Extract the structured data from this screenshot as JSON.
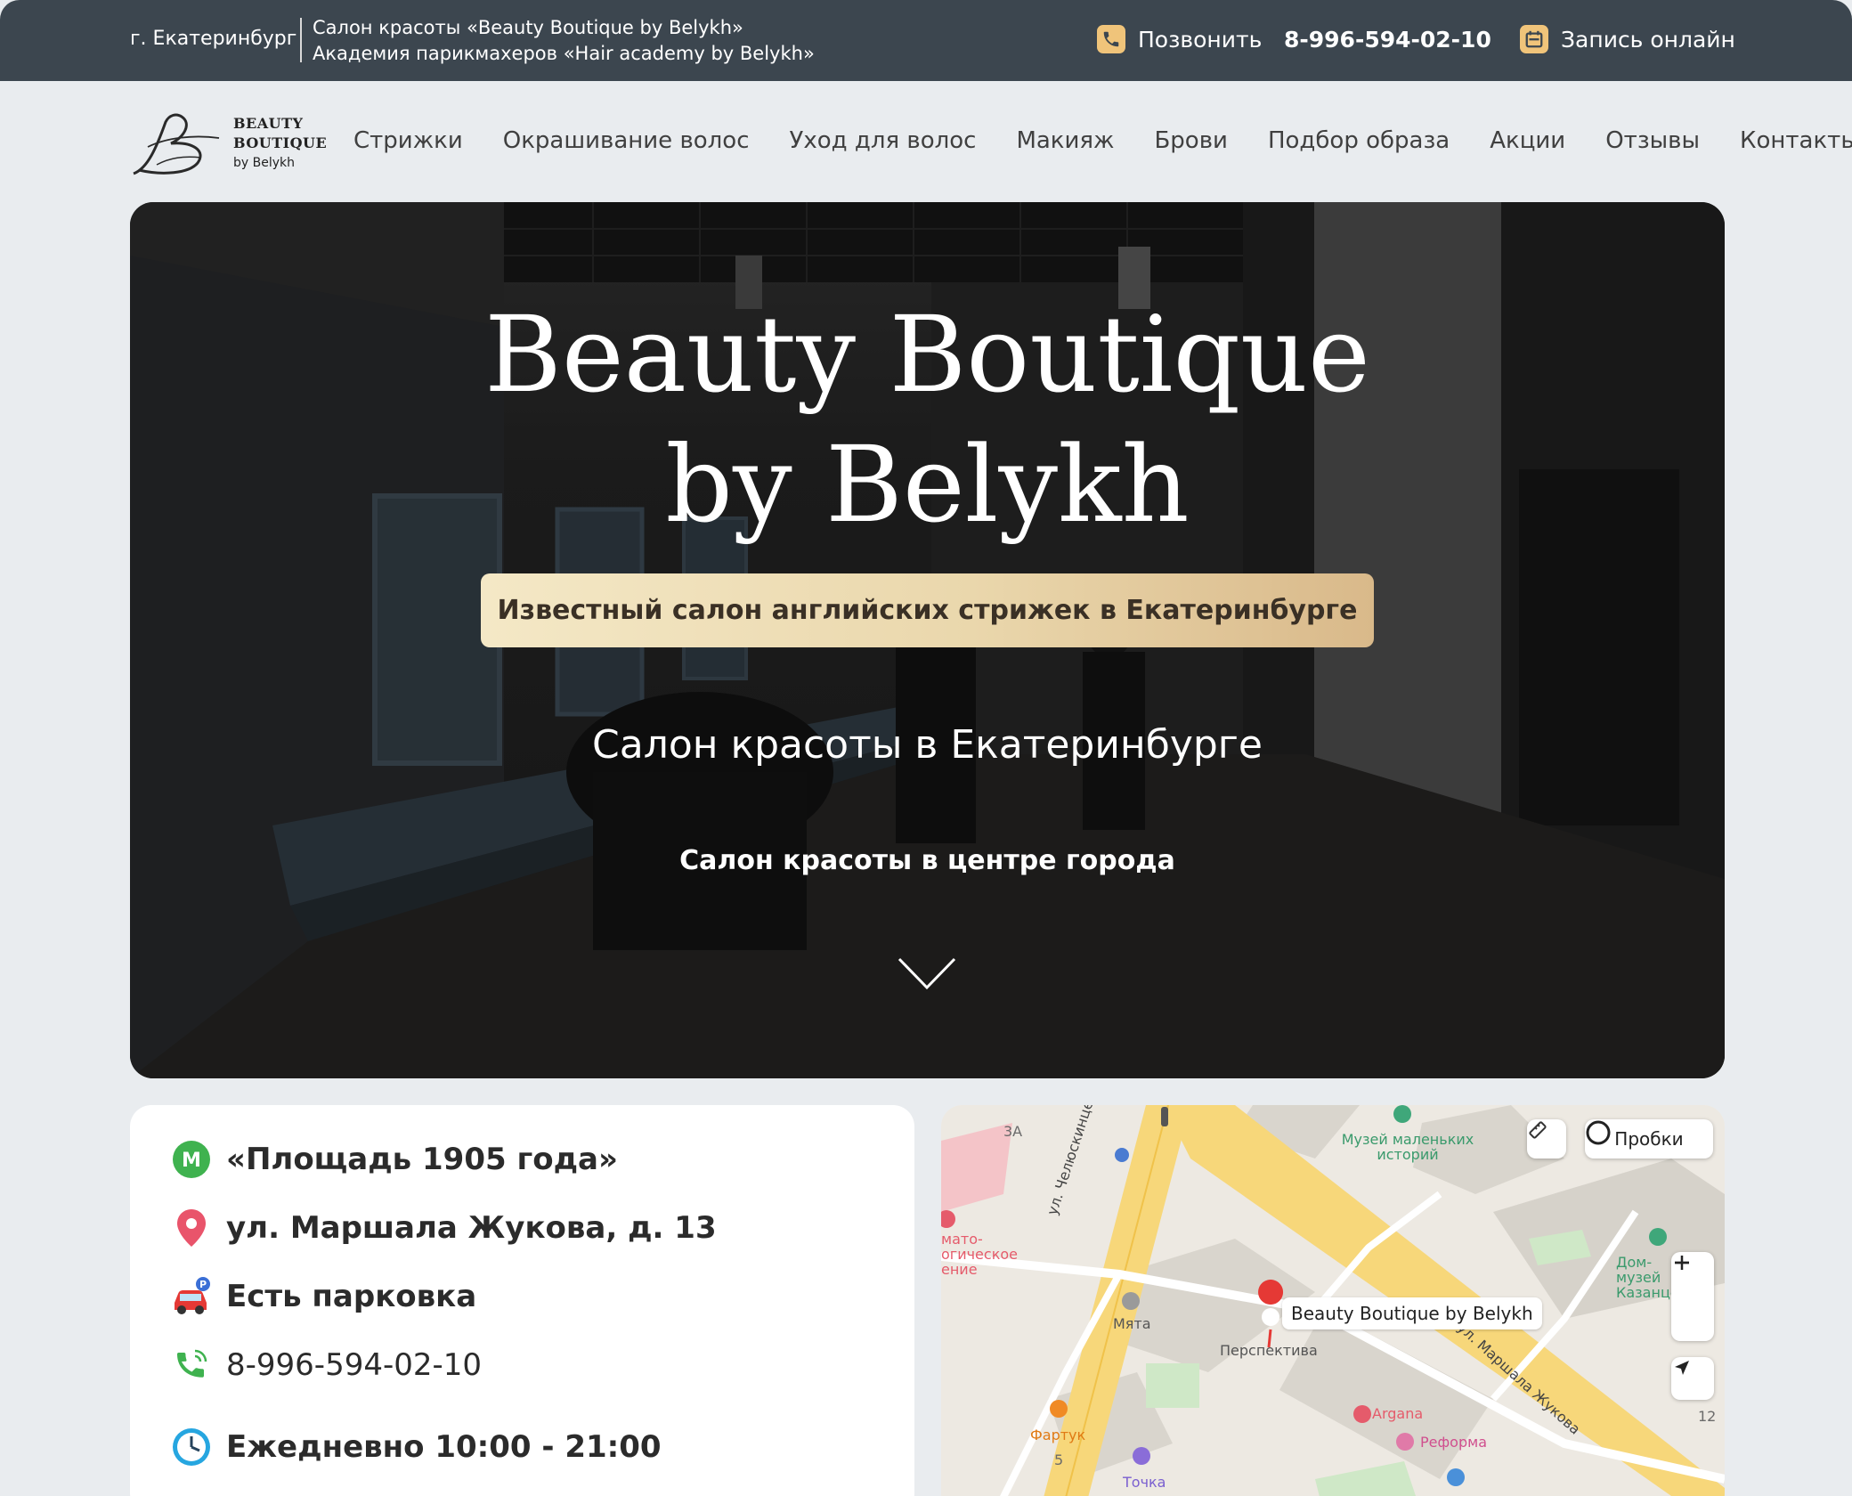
{
  "topbar": {
    "city": "г. Екатеринбург",
    "salon_line": "Салон красоты «Beauty Boutique by Belykh»",
    "academy_line": "Академия парикмахеров «Hair academy by Belykh»",
    "call_label": "Позвонить",
    "phone": "8-996-594-02-10",
    "book_label": "Запись онлайн"
  },
  "logo": {
    "line1": "BEAUTY",
    "line2": "BOUTIQUE",
    "line3": "by Belykh"
  },
  "menu": [
    "Стрижки",
    "Окрашивание волос",
    "Уход для волос",
    "Макияж",
    "Брови",
    "Подбор образа",
    "Акции",
    "Отзывы",
    "Контакты"
  ],
  "hero": {
    "title_line1": "Beauty Boutique",
    "title_line2": "by Belykh",
    "badge": "Известный салон английских стрижек в Екатеринбурге",
    "subtitle": "Салон красоты в Екатеринбурге",
    "tagline": "Салон красоты в центре города"
  },
  "info": {
    "metro_letter": "M",
    "metro": "«Площадь 1905 года»",
    "address": "ул. Маршала Жукова, д. 13",
    "parking": "Есть парковка",
    "phone": "8-996-594-02-10",
    "hours": "Ежедневно 10:00 - 21:00"
  },
  "map": {
    "traffic_label": "Пробки",
    "pin_label": "Beauty Boutique by Belykh",
    "street1": "ул. Челюскинцев",
    "street2": "ул. Маршала Жукова",
    "museum": "Музей маленьких историй",
    "house_museum": "Дом-музей Казанцева",
    "mint": "Мята",
    "perspective": "Перспектива",
    "argana": "Argana",
    "reforma": "Реформа",
    "fartuk": "Фартук",
    "tochka": "Точка",
    "clinic": "мато-огическое ение",
    "num_3a": "3А",
    "num_5": "5",
    "num_12": "12"
  },
  "colors": {
    "topbar": "#3c464f",
    "accent_gold": "#e6cfa0",
    "metro_green": "#3fb24f",
    "pin_red": "#e53935"
  }
}
